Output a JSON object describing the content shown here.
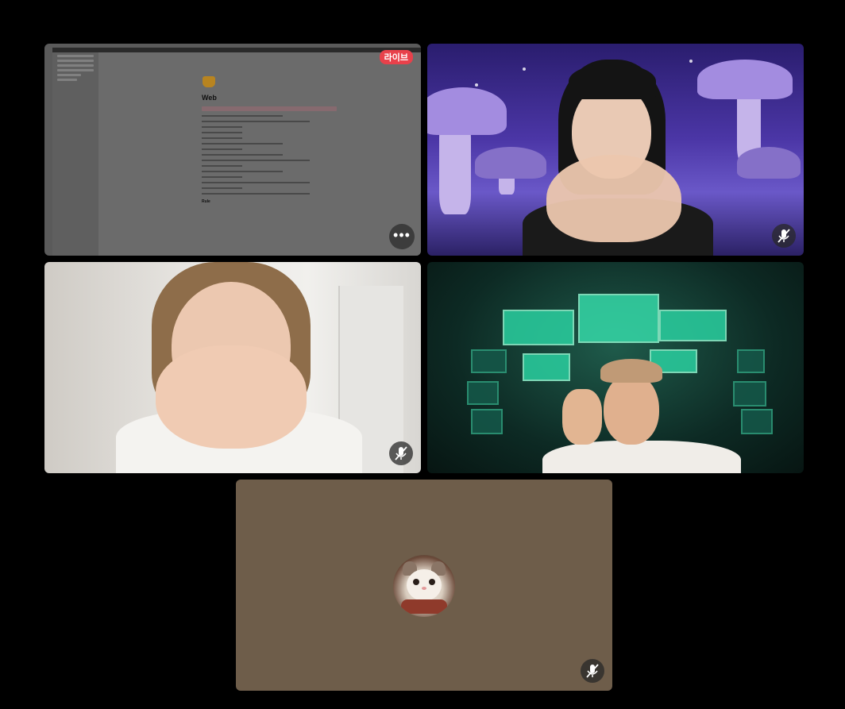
{
  "tiles": {
    "screen_share": {
      "live_label": "라이브",
      "more_label": "•••",
      "doc_title": "Web",
      "doc_section": "Rule"
    },
    "participant_2": {
      "muted": true
    },
    "participant_3": {
      "muted": true
    },
    "participant_4": {
      "muted": false
    },
    "participant_5": {
      "muted": true,
      "avatar": "cat-avatar"
    }
  },
  "colors": {
    "background": "#000000",
    "live_badge": "#e8414b",
    "camera_off_tile": "#6e5d4a"
  },
  "icons": [
    "more-icon",
    "mic-muted-icon",
    "cat-avatar"
  ]
}
